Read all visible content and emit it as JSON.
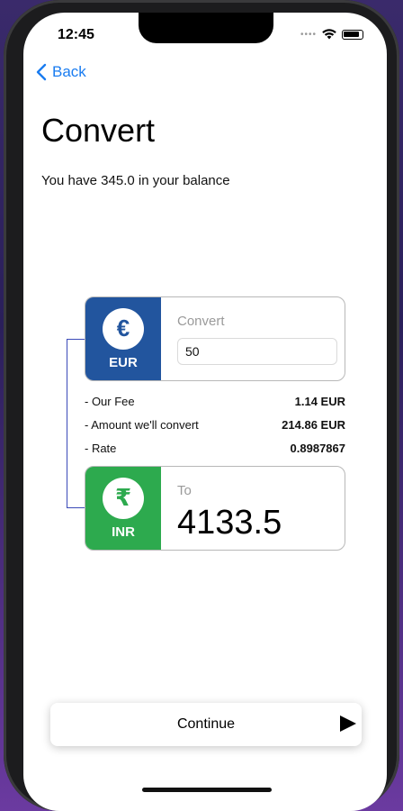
{
  "status_bar": {
    "time": "12:45"
  },
  "nav": {
    "back_label": "Back"
  },
  "page": {
    "title": "Convert",
    "balance_text": "You have 345.0 in your balance"
  },
  "from": {
    "currency_code": "EUR",
    "currency_symbol": "€",
    "label": "Convert",
    "amount_value": "50",
    "color": "#22559e"
  },
  "details": [
    {
      "label": "- Our Fee",
      "value": "1.14 EUR"
    },
    {
      "label": "- Amount we'll convert",
      "value": "214.86 EUR"
    },
    {
      "label": "- Rate",
      "value": "0.8987867"
    }
  ],
  "to": {
    "currency_code": "INR",
    "currency_symbol": "₹",
    "label": "To",
    "amount_value": "4133.5",
    "color": "#2daa4e"
  },
  "footer": {
    "continue_label": "Continue"
  },
  "icons": {
    "back": "chevron-left-icon",
    "continue": "play-icon",
    "wifi": "wifi-icon",
    "battery": "battery-icon"
  }
}
